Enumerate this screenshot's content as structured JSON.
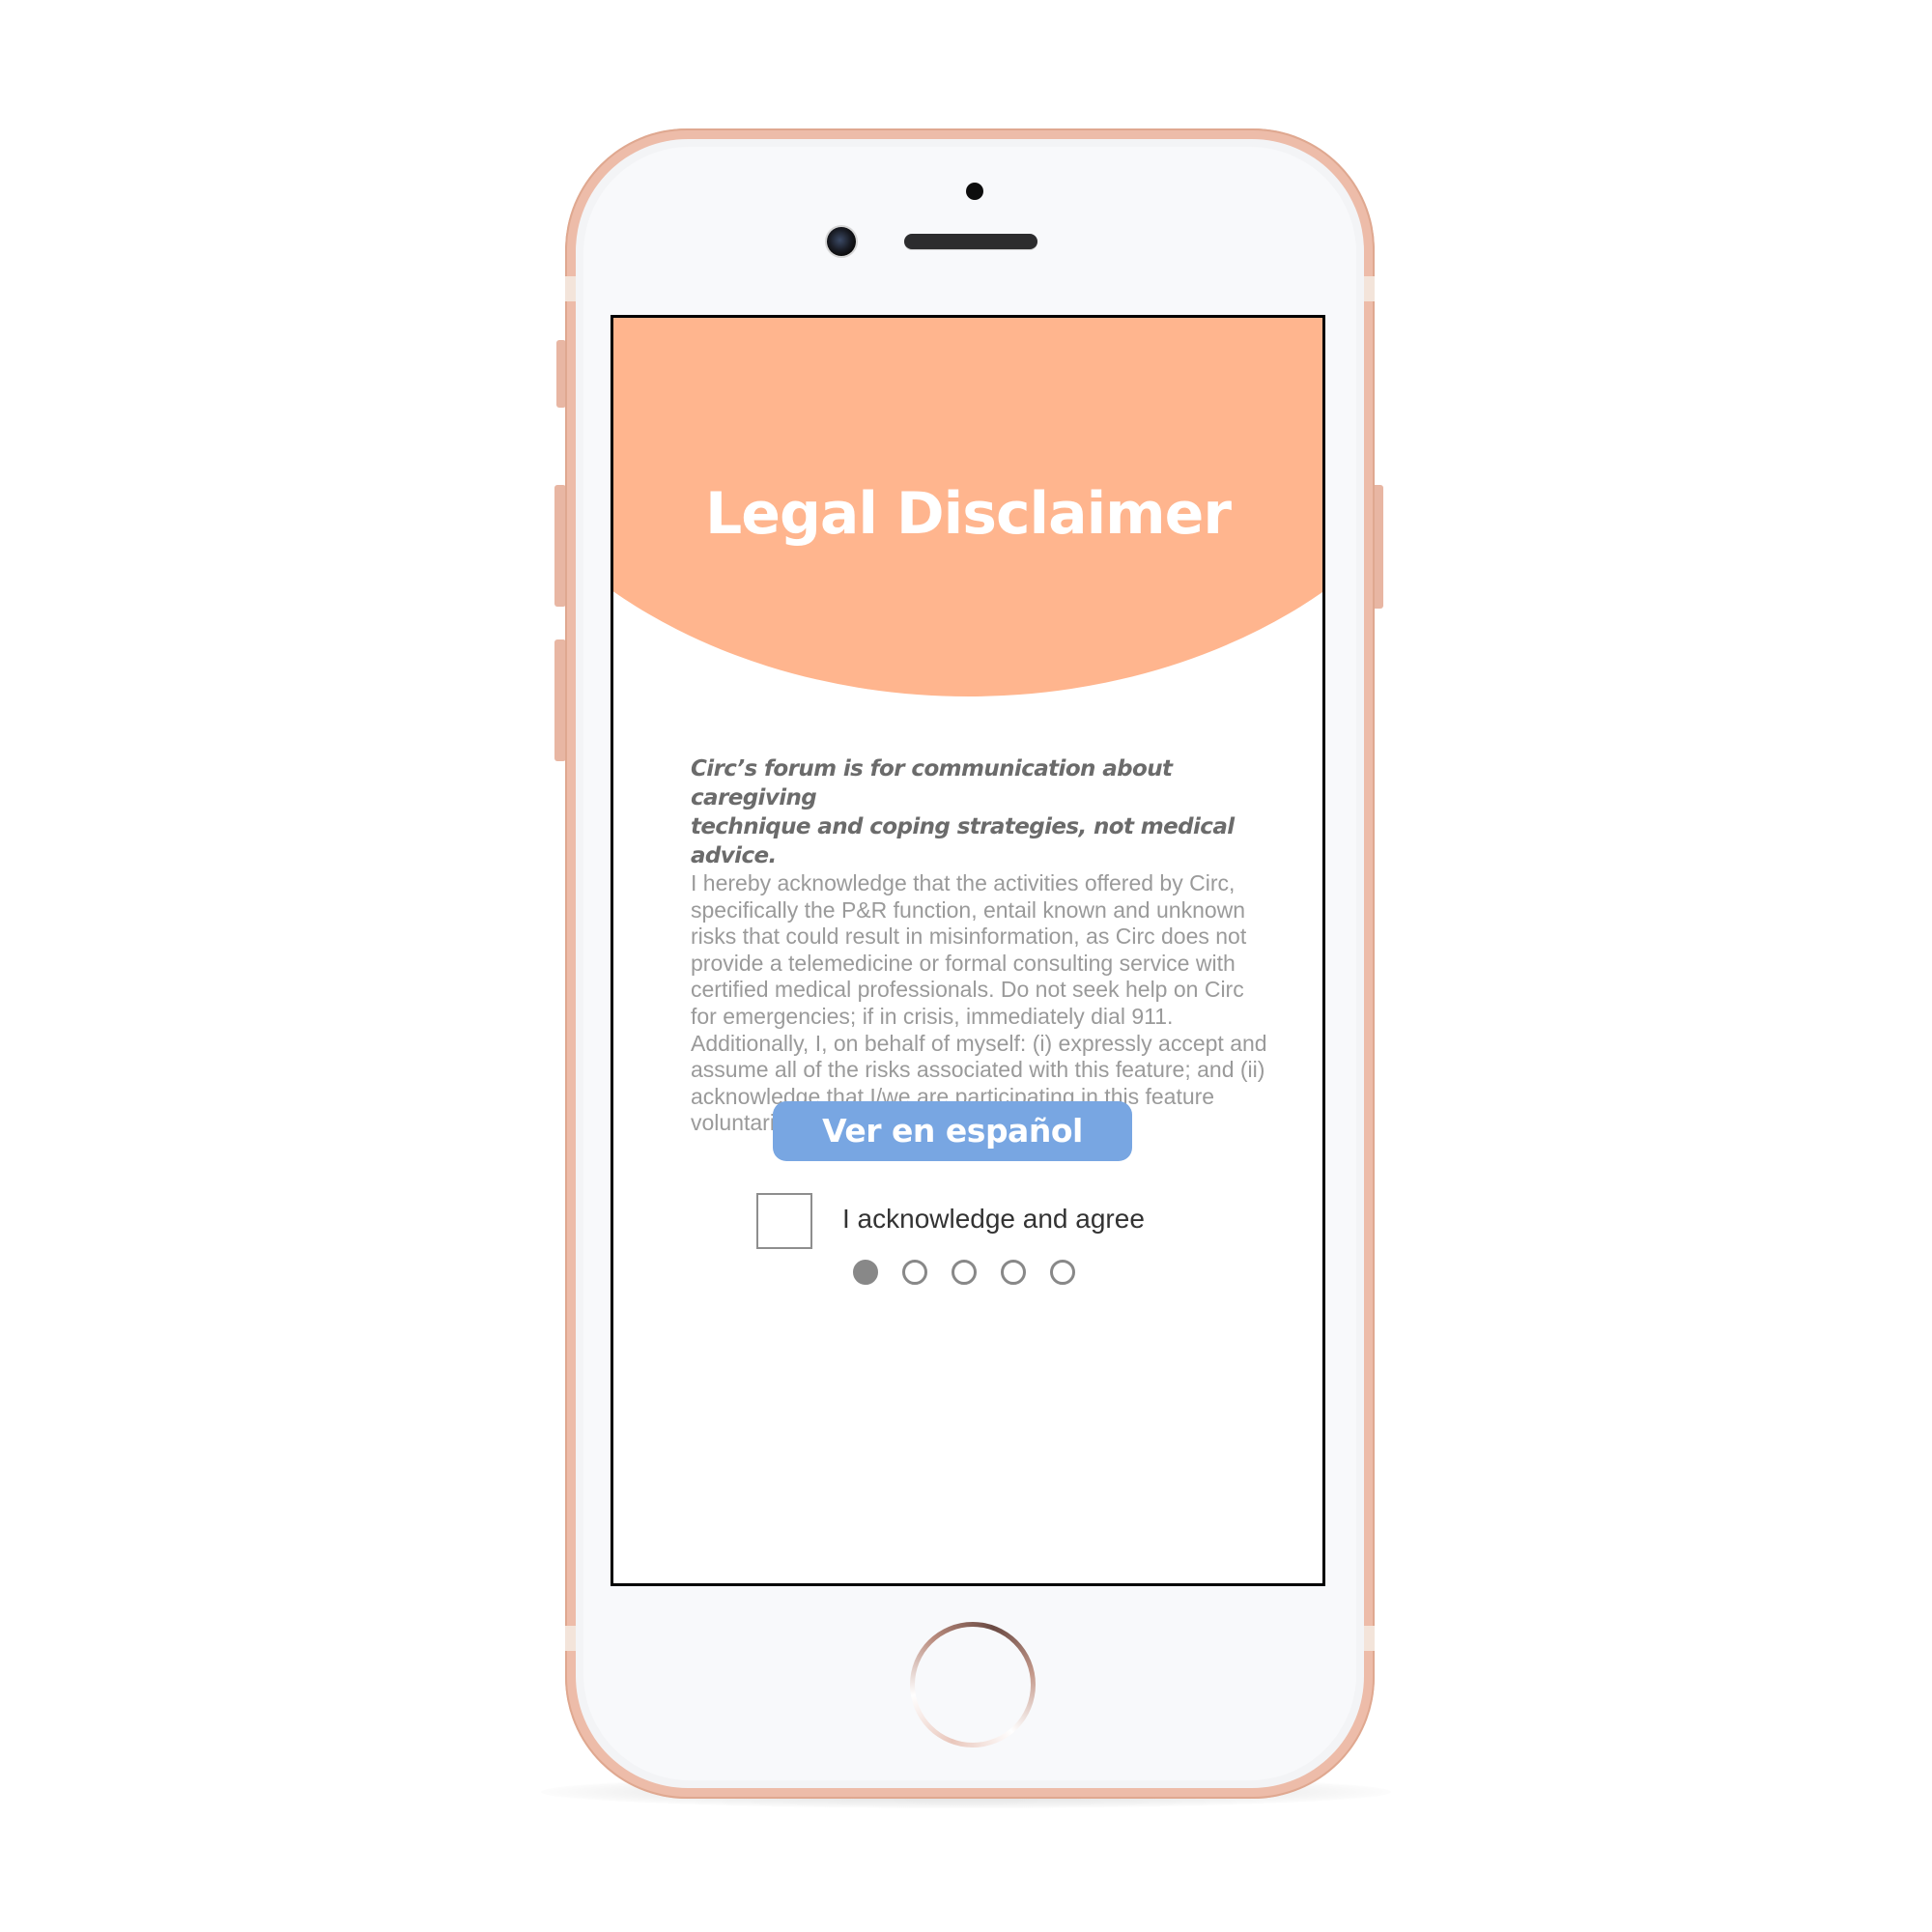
{
  "screen": {
    "title": "Legal Disclaimer",
    "lead_line_1": "Circ’s forum is for communication about caregiving",
    "lead_line_2": "technique and coping strategies, not medical advice.",
    "paragraph_lines": [
      "I hereby acknowledge that the activities offered by Circ,",
      "specifically the P&R function, entail known and unknown",
      "risks that could result in misinformation, as Circ does not",
      "provide a telemedicine or formal consulting service with",
      "certified medical professionals. Do not seek help on Circ",
      "for emergencies; if in crisis, immediately dial 911.",
      "Additionally, I, on behalf of myself: (i) expressly accept and",
      "assume all of the risks associated with this feature; and (ii)",
      "acknowledge that I/we are participating in this feature",
      "voluntarily in spite of the risks."
    ],
    "language_button_label": "Ver en español",
    "acknowledge": {
      "label": "I acknowledge and agree",
      "checked": false
    },
    "pagination": {
      "total_pages": 5,
      "current_page": 1
    }
  },
  "colors": {
    "header": "#ffb58e",
    "button": "#78a6e2",
    "phone_frame": "#edbca9"
  },
  "icons": {
    "home_button": "home-button-icon"
  }
}
